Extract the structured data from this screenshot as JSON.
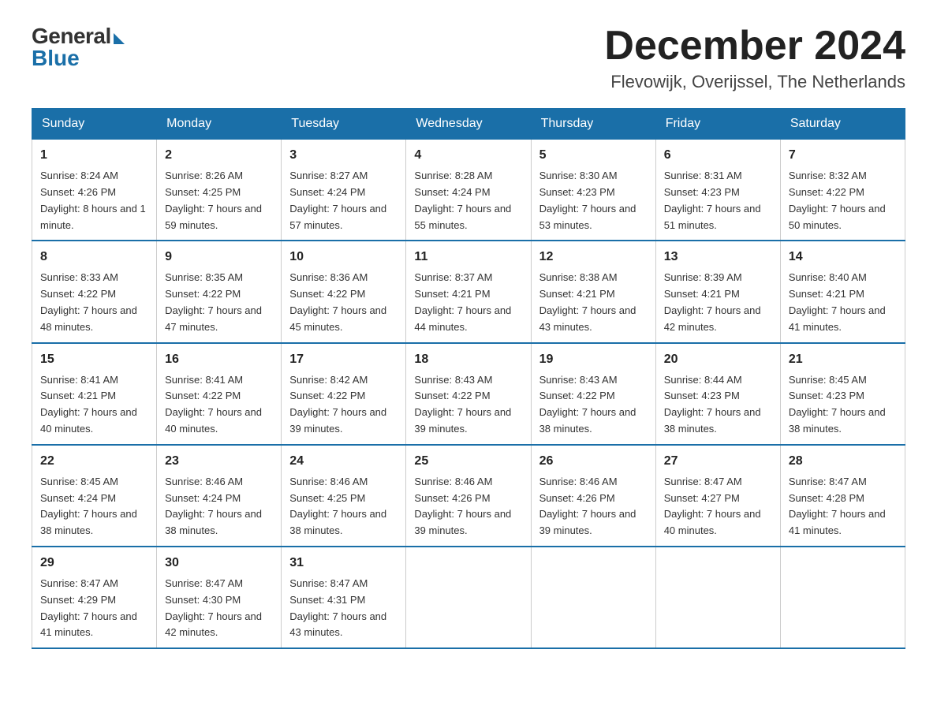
{
  "logo": {
    "general": "General",
    "blue": "Blue"
  },
  "title": "December 2024",
  "location": "Flevowijk, Overijssel, The Netherlands",
  "days_of_week": [
    "Sunday",
    "Monday",
    "Tuesday",
    "Wednesday",
    "Thursday",
    "Friday",
    "Saturday"
  ],
  "weeks": [
    [
      {
        "day": "1",
        "sunrise": "8:24 AM",
        "sunset": "4:26 PM",
        "daylight": "8 hours and 1 minute."
      },
      {
        "day": "2",
        "sunrise": "8:26 AM",
        "sunset": "4:25 PM",
        "daylight": "7 hours and 59 minutes."
      },
      {
        "day": "3",
        "sunrise": "8:27 AM",
        "sunset": "4:24 PM",
        "daylight": "7 hours and 57 minutes."
      },
      {
        "day": "4",
        "sunrise": "8:28 AM",
        "sunset": "4:24 PM",
        "daylight": "7 hours and 55 minutes."
      },
      {
        "day": "5",
        "sunrise": "8:30 AM",
        "sunset": "4:23 PM",
        "daylight": "7 hours and 53 minutes."
      },
      {
        "day": "6",
        "sunrise": "8:31 AM",
        "sunset": "4:23 PM",
        "daylight": "7 hours and 51 minutes."
      },
      {
        "day": "7",
        "sunrise": "8:32 AM",
        "sunset": "4:22 PM",
        "daylight": "7 hours and 50 minutes."
      }
    ],
    [
      {
        "day": "8",
        "sunrise": "8:33 AM",
        "sunset": "4:22 PM",
        "daylight": "7 hours and 48 minutes."
      },
      {
        "day": "9",
        "sunrise": "8:35 AM",
        "sunset": "4:22 PM",
        "daylight": "7 hours and 47 minutes."
      },
      {
        "day": "10",
        "sunrise": "8:36 AM",
        "sunset": "4:22 PM",
        "daylight": "7 hours and 45 minutes."
      },
      {
        "day": "11",
        "sunrise": "8:37 AM",
        "sunset": "4:21 PM",
        "daylight": "7 hours and 44 minutes."
      },
      {
        "day": "12",
        "sunrise": "8:38 AM",
        "sunset": "4:21 PM",
        "daylight": "7 hours and 43 minutes."
      },
      {
        "day": "13",
        "sunrise": "8:39 AM",
        "sunset": "4:21 PM",
        "daylight": "7 hours and 42 minutes."
      },
      {
        "day": "14",
        "sunrise": "8:40 AM",
        "sunset": "4:21 PM",
        "daylight": "7 hours and 41 minutes."
      }
    ],
    [
      {
        "day": "15",
        "sunrise": "8:41 AM",
        "sunset": "4:21 PM",
        "daylight": "7 hours and 40 minutes."
      },
      {
        "day": "16",
        "sunrise": "8:41 AM",
        "sunset": "4:22 PM",
        "daylight": "7 hours and 40 minutes."
      },
      {
        "day": "17",
        "sunrise": "8:42 AM",
        "sunset": "4:22 PM",
        "daylight": "7 hours and 39 minutes."
      },
      {
        "day": "18",
        "sunrise": "8:43 AM",
        "sunset": "4:22 PM",
        "daylight": "7 hours and 39 minutes."
      },
      {
        "day": "19",
        "sunrise": "8:43 AM",
        "sunset": "4:22 PM",
        "daylight": "7 hours and 38 minutes."
      },
      {
        "day": "20",
        "sunrise": "8:44 AM",
        "sunset": "4:23 PM",
        "daylight": "7 hours and 38 minutes."
      },
      {
        "day": "21",
        "sunrise": "8:45 AM",
        "sunset": "4:23 PM",
        "daylight": "7 hours and 38 minutes."
      }
    ],
    [
      {
        "day": "22",
        "sunrise": "8:45 AM",
        "sunset": "4:24 PM",
        "daylight": "7 hours and 38 minutes."
      },
      {
        "day": "23",
        "sunrise": "8:46 AM",
        "sunset": "4:24 PM",
        "daylight": "7 hours and 38 minutes."
      },
      {
        "day": "24",
        "sunrise": "8:46 AM",
        "sunset": "4:25 PM",
        "daylight": "7 hours and 38 minutes."
      },
      {
        "day": "25",
        "sunrise": "8:46 AM",
        "sunset": "4:26 PM",
        "daylight": "7 hours and 39 minutes."
      },
      {
        "day": "26",
        "sunrise": "8:46 AM",
        "sunset": "4:26 PM",
        "daylight": "7 hours and 39 minutes."
      },
      {
        "day": "27",
        "sunrise": "8:47 AM",
        "sunset": "4:27 PM",
        "daylight": "7 hours and 40 minutes."
      },
      {
        "day": "28",
        "sunrise": "8:47 AM",
        "sunset": "4:28 PM",
        "daylight": "7 hours and 41 minutes."
      }
    ],
    [
      {
        "day": "29",
        "sunrise": "8:47 AM",
        "sunset": "4:29 PM",
        "daylight": "7 hours and 41 minutes."
      },
      {
        "day": "30",
        "sunrise": "8:47 AM",
        "sunset": "4:30 PM",
        "daylight": "7 hours and 42 minutes."
      },
      {
        "day": "31",
        "sunrise": "8:47 AM",
        "sunset": "4:31 PM",
        "daylight": "7 hours and 43 minutes."
      },
      null,
      null,
      null,
      null
    ]
  ]
}
